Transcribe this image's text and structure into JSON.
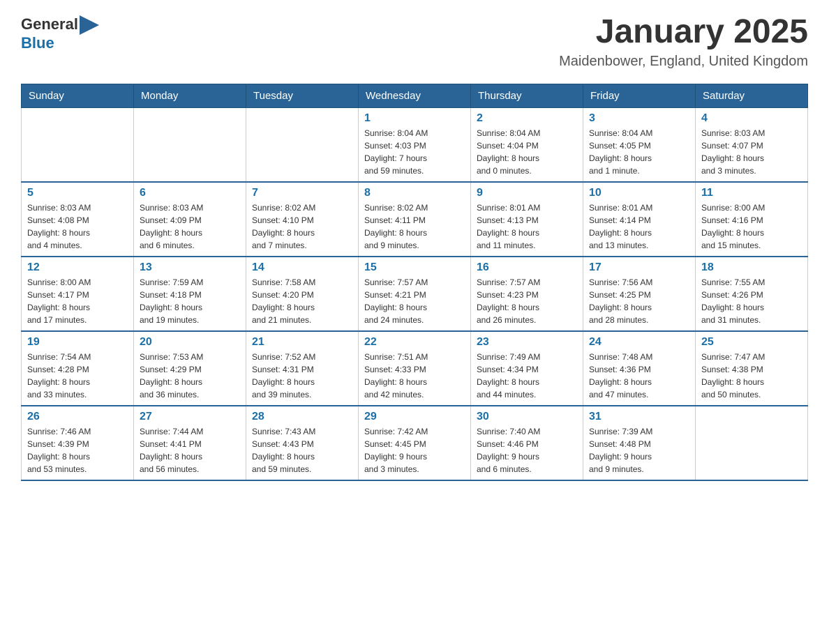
{
  "header": {
    "logo_general": "General",
    "logo_blue": "Blue",
    "title": "January 2025",
    "subtitle": "Maidenbower, England, United Kingdom"
  },
  "days_of_week": [
    "Sunday",
    "Monday",
    "Tuesday",
    "Wednesday",
    "Thursday",
    "Friday",
    "Saturday"
  ],
  "weeks": [
    [
      {
        "day": "",
        "info": ""
      },
      {
        "day": "",
        "info": ""
      },
      {
        "day": "",
        "info": ""
      },
      {
        "day": "1",
        "info": "Sunrise: 8:04 AM\nSunset: 4:03 PM\nDaylight: 7 hours\nand 59 minutes."
      },
      {
        "day": "2",
        "info": "Sunrise: 8:04 AM\nSunset: 4:04 PM\nDaylight: 8 hours\nand 0 minutes."
      },
      {
        "day": "3",
        "info": "Sunrise: 8:04 AM\nSunset: 4:05 PM\nDaylight: 8 hours\nand 1 minute."
      },
      {
        "day": "4",
        "info": "Sunrise: 8:03 AM\nSunset: 4:07 PM\nDaylight: 8 hours\nand 3 minutes."
      }
    ],
    [
      {
        "day": "5",
        "info": "Sunrise: 8:03 AM\nSunset: 4:08 PM\nDaylight: 8 hours\nand 4 minutes."
      },
      {
        "day": "6",
        "info": "Sunrise: 8:03 AM\nSunset: 4:09 PM\nDaylight: 8 hours\nand 6 minutes."
      },
      {
        "day": "7",
        "info": "Sunrise: 8:02 AM\nSunset: 4:10 PM\nDaylight: 8 hours\nand 7 minutes."
      },
      {
        "day": "8",
        "info": "Sunrise: 8:02 AM\nSunset: 4:11 PM\nDaylight: 8 hours\nand 9 minutes."
      },
      {
        "day": "9",
        "info": "Sunrise: 8:01 AM\nSunset: 4:13 PM\nDaylight: 8 hours\nand 11 minutes."
      },
      {
        "day": "10",
        "info": "Sunrise: 8:01 AM\nSunset: 4:14 PM\nDaylight: 8 hours\nand 13 minutes."
      },
      {
        "day": "11",
        "info": "Sunrise: 8:00 AM\nSunset: 4:16 PM\nDaylight: 8 hours\nand 15 minutes."
      }
    ],
    [
      {
        "day": "12",
        "info": "Sunrise: 8:00 AM\nSunset: 4:17 PM\nDaylight: 8 hours\nand 17 minutes."
      },
      {
        "day": "13",
        "info": "Sunrise: 7:59 AM\nSunset: 4:18 PM\nDaylight: 8 hours\nand 19 minutes."
      },
      {
        "day": "14",
        "info": "Sunrise: 7:58 AM\nSunset: 4:20 PM\nDaylight: 8 hours\nand 21 minutes."
      },
      {
        "day": "15",
        "info": "Sunrise: 7:57 AM\nSunset: 4:21 PM\nDaylight: 8 hours\nand 24 minutes."
      },
      {
        "day": "16",
        "info": "Sunrise: 7:57 AM\nSunset: 4:23 PM\nDaylight: 8 hours\nand 26 minutes."
      },
      {
        "day": "17",
        "info": "Sunrise: 7:56 AM\nSunset: 4:25 PM\nDaylight: 8 hours\nand 28 minutes."
      },
      {
        "day": "18",
        "info": "Sunrise: 7:55 AM\nSunset: 4:26 PM\nDaylight: 8 hours\nand 31 minutes."
      }
    ],
    [
      {
        "day": "19",
        "info": "Sunrise: 7:54 AM\nSunset: 4:28 PM\nDaylight: 8 hours\nand 33 minutes."
      },
      {
        "day": "20",
        "info": "Sunrise: 7:53 AM\nSunset: 4:29 PM\nDaylight: 8 hours\nand 36 minutes."
      },
      {
        "day": "21",
        "info": "Sunrise: 7:52 AM\nSunset: 4:31 PM\nDaylight: 8 hours\nand 39 minutes."
      },
      {
        "day": "22",
        "info": "Sunrise: 7:51 AM\nSunset: 4:33 PM\nDaylight: 8 hours\nand 42 minutes."
      },
      {
        "day": "23",
        "info": "Sunrise: 7:49 AM\nSunset: 4:34 PM\nDaylight: 8 hours\nand 44 minutes."
      },
      {
        "day": "24",
        "info": "Sunrise: 7:48 AM\nSunset: 4:36 PM\nDaylight: 8 hours\nand 47 minutes."
      },
      {
        "day": "25",
        "info": "Sunrise: 7:47 AM\nSunset: 4:38 PM\nDaylight: 8 hours\nand 50 minutes."
      }
    ],
    [
      {
        "day": "26",
        "info": "Sunrise: 7:46 AM\nSunset: 4:39 PM\nDaylight: 8 hours\nand 53 minutes."
      },
      {
        "day": "27",
        "info": "Sunrise: 7:44 AM\nSunset: 4:41 PM\nDaylight: 8 hours\nand 56 minutes."
      },
      {
        "day": "28",
        "info": "Sunrise: 7:43 AM\nSunset: 4:43 PM\nDaylight: 8 hours\nand 59 minutes."
      },
      {
        "day": "29",
        "info": "Sunrise: 7:42 AM\nSunset: 4:45 PM\nDaylight: 9 hours\nand 3 minutes."
      },
      {
        "day": "30",
        "info": "Sunrise: 7:40 AM\nSunset: 4:46 PM\nDaylight: 9 hours\nand 6 minutes."
      },
      {
        "day": "31",
        "info": "Sunrise: 7:39 AM\nSunset: 4:48 PM\nDaylight: 9 hours\nand 9 minutes."
      },
      {
        "day": "",
        "info": ""
      }
    ]
  ]
}
